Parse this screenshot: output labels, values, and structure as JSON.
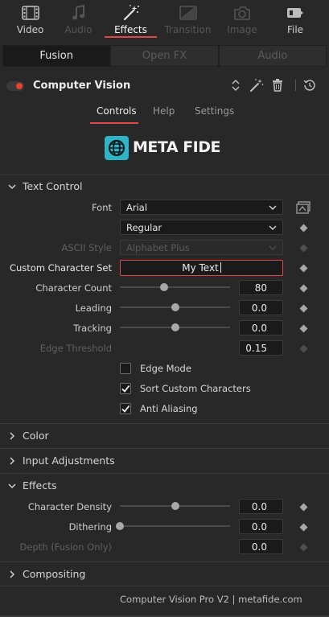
{
  "top_tabs": [
    {
      "label": "Video",
      "icon": "film-icon",
      "state": "normal"
    },
    {
      "label": "Audio",
      "icon": "music-note-icon",
      "state": "disabled"
    },
    {
      "label": "Effects",
      "icon": "magic-wand-icon",
      "state": "active"
    },
    {
      "label": "Transition",
      "icon": "transition-icon",
      "state": "disabled"
    },
    {
      "label": "Image",
      "icon": "image-icon",
      "state": "disabled"
    },
    {
      "label": "File",
      "icon": "file-icon",
      "state": "normal"
    }
  ],
  "sub_tabs": [
    {
      "label": "Fusion",
      "state": "active"
    },
    {
      "label": "Open FX",
      "state": "disabled"
    },
    {
      "label": "Audio",
      "state": "disabled"
    }
  ],
  "header": {
    "title": "Computer Vision",
    "enabled": true
  },
  "secondary_tabs": [
    {
      "label": "Controls",
      "state": "active"
    },
    {
      "label": "Help",
      "state": "normal"
    },
    {
      "label": "Settings",
      "state": "normal"
    }
  ],
  "logo": {
    "text": "META FIDE"
  },
  "text_control": {
    "heading": "Text Control",
    "font_label": "Font",
    "font_value": "Arial",
    "font_style": "Regular",
    "ascii_style_label": "ASCII Style",
    "ascii_style_value": "Alphabet Plus",
    "custom_set_label": "Custom Character Set",
    "custom_set_value": "My Text",
    "char_count_label": "Character Count",
    "char_count_value": "80",
    "char_count_level": 0.4,
    "leading_label": "Leading",
    "leading_value": "0.0",
    "leading_level": 0.5,
    "tracking_label": "Tracking",
    "tracking_value": "0.0",
    "tracking_level": 0.5,
    "edge_threshold_label": "Edge Threshold",
    "edge_threshold_value": "0.15",
    "edge_mode_label": "Edge Mode",
    "edge_mode_checked": false,
    "sort_custom_label": "Sort Custom Characters",
    "sort_custom_checked": true,
    "anti_alias_label": "Anti Aliasing",
    "anti_alias_checked": true
  },
  "sections": {
    "color": "Color",
    "input_adjustments": "Input Adjustments",
    "effects": "Effects",
    "compositing": "Compositing"
  },
  "effects": {
    "density_label": "Character Density",
    "density_value": "0.0",
    "density_level": 0.5,
    "dithering_label": "Dithering",
    "dithering_value": "0.0",
    "dithering_level": 0.0,
    "depth_label": "Depth (Fusion Only)",
    "depth_value": "0.0"
  },
  "footer": "Computer Vision Pro V2 | metafide.com",
  "colors": {
    "accent": "#e04848",
    "logo": "#2fb3c6",
    "toggle_dot": "#e8412c"
  }
}
